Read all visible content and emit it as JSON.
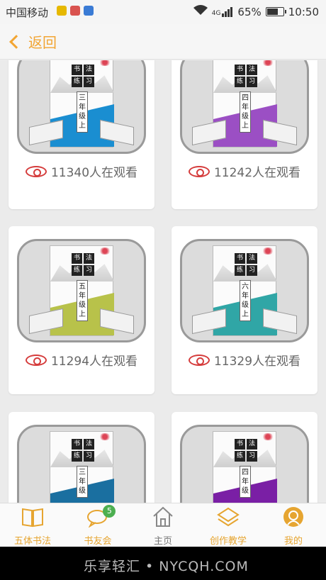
{
  "status_bar": {
    "carrier": "中国移动",
    "network": "4G",
    "battery": "65%",
    "time": "10:50"
  },
  "header": {
    "back_label": "返回"
  },
  "books": [
    {
      "views_text": "11340人在观看",
      "cover_label": "三年级上",
      "cover_color": "#1a8ed1"
    },
    {
      "views_text": "11242人在观看",
      "cover_label": "四年级上",
      "cover_color": "#9b4fc4"
    },
    {
      "views_text": "11294人在观看",
      "cover_label": "五年级上",
      "cover_color": "#b8c24a"
    },
    {
      "views_text": "11329人在观看",
      "cover_label": "六年级上",
      "cover_color": "#30a6a6"
    },
    {
      "views_text": "",
      "cover_label": "三年级",
      "cover_color": "#1a6fa0"
    },
    {
      "views_text": "",
      "cover_label": "四年级",
      "cover_color": "#7a1fa5"
    }
  ],
  "cover_title_chars": [
    "书",
    "法",
    "练",
    "习"
  ],
  "tabbar": {
    "items": [
      {
        "label": "五体书法",
        "icon": "book-icon"
      },
      {
        "label": "书友会",
        "icon": "chat-icon",
        "badge": "5"
      },
      {
        "label": "主页",
        "icon": "home-icon"
      },
      {
        "label": "创作教学",
        "icon": "layers-icon"
      },
      {
        "label": "我的",
        "icon": "profile-icon"
      }
    ]
  },
  "watermark": "乐享轻汇 • NYCQH.COM",
  "colors": {
    "accent": "#f2a533",
    "eye": "#d53c3c",
    "badge": "#4caf50"
  }
}
